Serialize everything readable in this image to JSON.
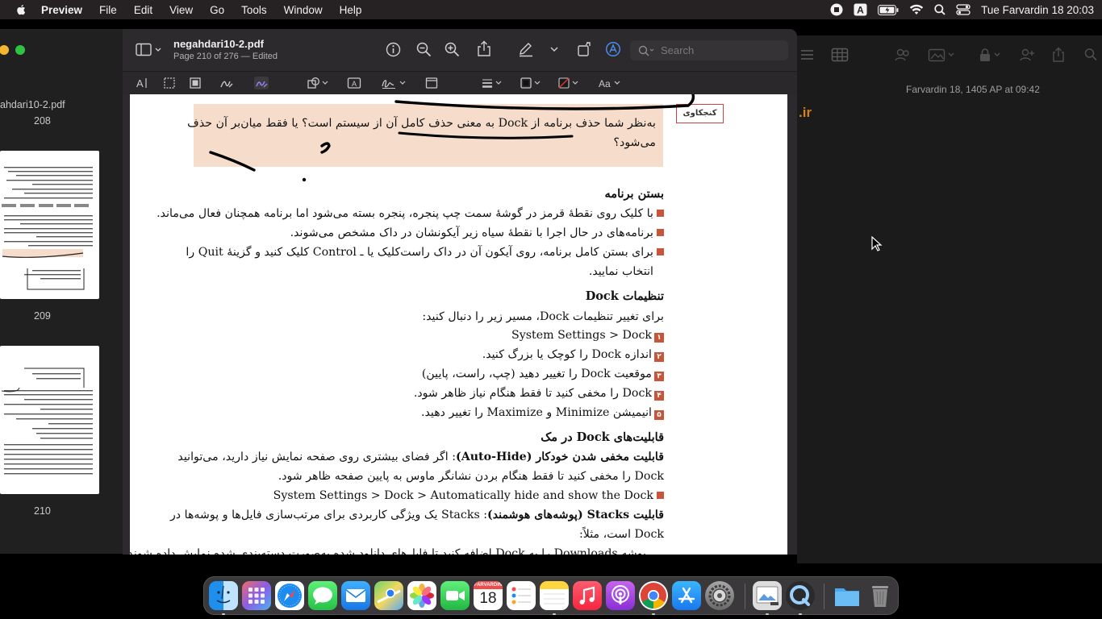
{
  "menubar": {
    "app_name": "Preview",
    "menus": [
      "File",
      "Edit",
      "View",
      "Go",
      "Tools",
      "Window",
      "Help"
    ],
    "clock": "Tue Farvardin 18  20:03"
  },
  "sidebar": {
    "partial_filename": "ahdari10-2.pdf",
    "pages": [
      "208",
      "209",
      "210"
    ]
  },
  "window": {
    "filename": "negahdari10-2.pdf",
    "subtitle": "Page 210 of 276 — Edited",
    "search_placeholder": "Search"
  },
  "page": {
    "note_tag": "کنجکاوی",
    "note_line1": "به‌نظر شما حذف برنامه از Dock به معنی حذف کامل آن از سیستم است؟ یا فقط میان‌بر آن حذف",
    "note_line2": "می‌شود؟",
    "h1": "بستن برنامه",
    "b1": "با کلیک روی نقطهٔ قرمز در گوشهٔ سمت چپ پنجره، پنجره بسته می‌شود اما برنامه همچنان فعال می‌ماند.",
    "b2": "برنامه‌های در حال اجرا با نقطهٔ سیاه زیر آیکونشان در داک مشخص می‌شوند.",
    "b3": "برای بستن کامل برنامه، روی آیکون آن در داک راست‌کلیک یا ـ Control کلیک کنید و گزینهٔ Quit را",
    "b3_cont": "انتخاب نمایید.",
    "h2": "تنظیمات Dock",
    "p1": "برای تغییر تنظیمات Dock، مسیر زیر را دنبال کنید:",
    "n1": "System Settings > Dock",
    "n2": "اندازه Dock را کوچک یا بزرگ کنید.",
    "n3": "موقعیت Dock را تغییر دهید (چپ، راست، پایین)",
    "n4": "Dock را مخفی کنید تا فقط هنگام نیاز ظاهر شود.",
    "n5": "انیمیشن Minimize و Maximize را تغییر دهید.",
    "nums": [
      "۱",
      "۲",
      "۳",
      "۴",
      "۵"
    ],
    "h3": "قابلیت‌های Dock در مک",
    "ah_bold": "قابلیت مخفی شدن خودکار (Auto-Hide)",
    "ah_rest": ": اگر فضای بیشتری روی صفحه نمایش نیاز دارید، می‌توانید",
    "ah_line2": "Dock را مخفی کنید تا فقط هنگام بردن نشانگر ماوس به پایین صفحه ظاهر شود.",
    "ah_path": "System  Settings > Dock > Automatically hide and show the Dock",
    "st_bold": "قابلیت Stacks (پوشه‌های هوشمند)",
    "st_rest": ": Stacks یک ویژگی کاربردی برای مرتب‌سازی فایل‌ها و پوشه‌ها در",
    "st_line2": "Dock است، مثلاً:",
    "st_line3": "پوشه Downloads را به Dock اضافه کنید تا فایل‌های دانلود شده به‌صورت دسته‌بندی شده نمایش داده شوند."
  },
  "right_window": {
    "date": "Farvardin 18, 1405 AP at 09:42",
    "fragment": ".ir"
  },
  "dock": {
    "calendar_month": "FARVARDIN",
    "calendar_day": "18"
  },
  "colors": {
    "accent_blue": "#4a8ef0",
    "note_bg": "#f6dccb",
    "bullet": "#c7553a"
  }
}
